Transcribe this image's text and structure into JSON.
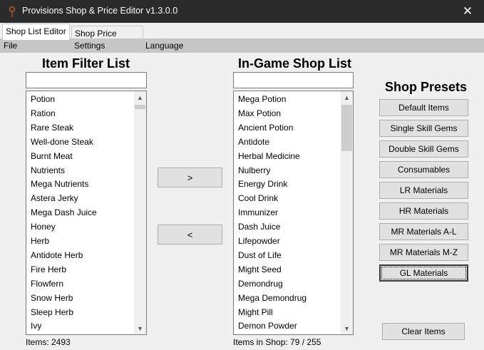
{
  "window": {
    "title": "Provisions Shop & Price Editor v1.3.0.0",
    "close_glyph": "✕"
  },
  "tabs": [
    "Shop List Editor",
    "Shop Price Editor"
  ],
  "menu": [
    "File",
    "Settings",
    "Language"
  ],
  "filter_panel": {
    "title": "Item Filter List",
    "search_value": "",
    "items": [
      "Potion",
      "Ration",
      "Rare Steak",
      "Well-done Steak",
      "Burnt Meat",
      "Nutrients",
      "Mega Nutrients",
      "Astera Jerky",
      "Mega Dash Juice",
      "Honey",
      "Herb",
      "Antidote Herb",
      "Fire Herb",
      "Flowfern",
      "Snow Herb",
      "Sleep Herb",
      "Ivy"
    ],
    "status": "Items: 2493"
  },
  "transfer": {
    "add_label": ">",
    "remove_label": "<"
  },
  "shop_panel": {
    "title": "In-Game Shop List",
    "search_value": "",
    "items": [
      "Mega Potion",
      "Max Potion",
      "Ancient Potion",
      "Antidote",
      "Herbal Medicine",
      "Nulberry",
      "Energy Drink",
      "Cool Drink",
      "Immunizer",
      "Dash Juice",
      "Lifepowder",
      "Dust of Life",
      "Might Seed",
      "Demondrug",
      "Mega Demondrug",
      "Might Pill",
      "Demon Powder"
    ],
    "status": "Items in Shop: 79 / 255"
  },
  "presets": {
    "title": "Shop Presets",
    "buttons": [
      "Default Items",
      "Single Skill Gems",
      "Double Skill Gems",
      "Consumables",
      "LR Materials",
      "HR Materials",
      "MR Materials A-L",
      "MR Materials M-Z",
      "GL Materials"
    ],
    "focused_index": 8,
    "clear_label": "Clear Items"
  },
  "icons": {
    "scroll_up": "▲",
    "scroll_down": "▼"
  },
  "colors": {
    "titlebar": "#2b2b2b",
    "menubar": "#c6c6c6",
    "button_face": "#e1e1e1"
  }
}
